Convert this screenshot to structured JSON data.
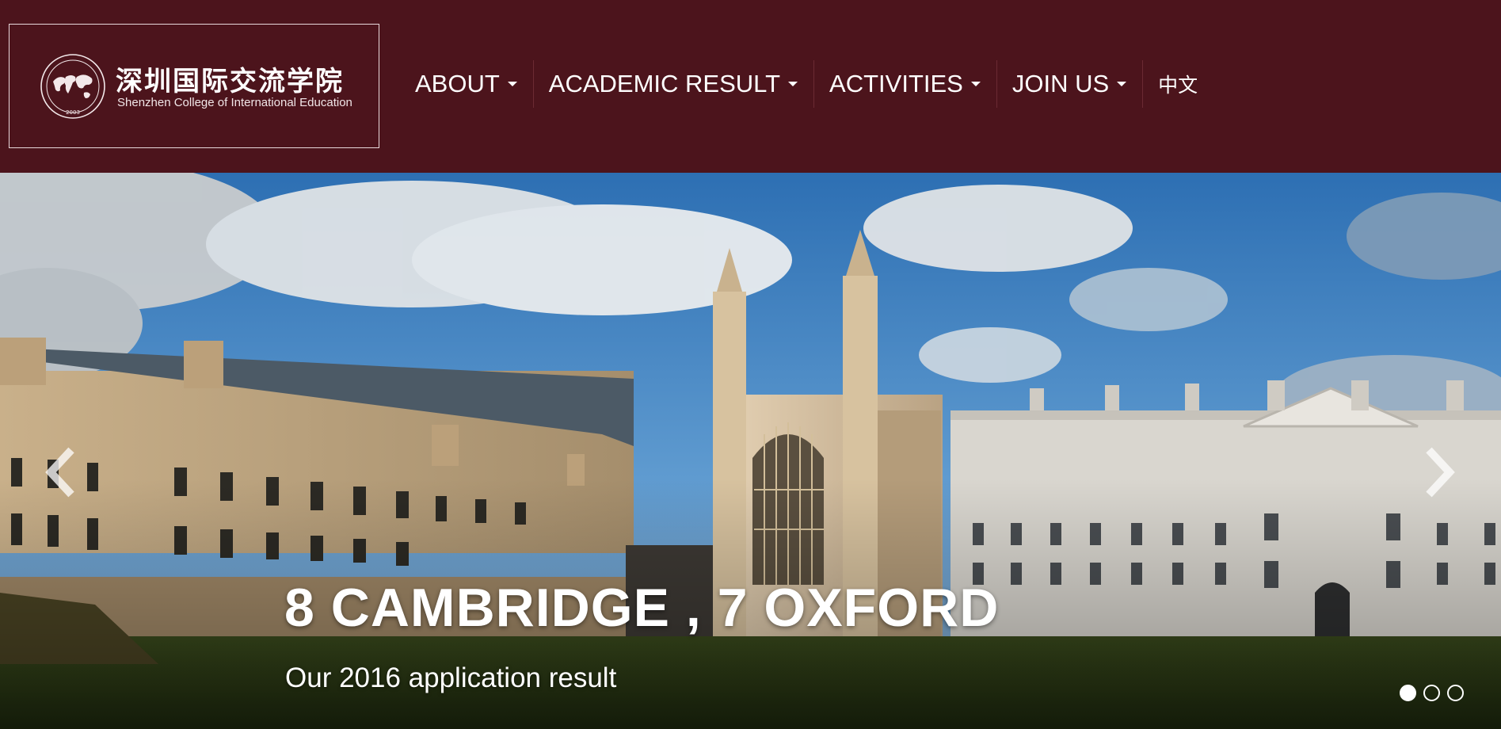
{
  "brand": {
    "name_cn": "深圳国际交流学院",
    "name_en": "Shenzhen College of International Education",
    "seal_year": "2003"
  },
  "nav": {
    "items": [
      {
        "label": "ABOUT",
        "has_dropdown": true
      },
      {
        "label": "ACADEMIC RESULT",
        "has_dropdown": true
      },
      {
        "label": "ACTIVITIES",
        "has_dropdown": true
      },
      {
        "label": "JOIN US",
        "has_dropdown": true
      }
    ],
    "language_label": "中文"
  },
  "hero": {
    "headline": "8 CAMBRIDGE , 7 OXFORD",
    "subline": "Our 2016 application result",
    "prev_icon": "chevron-left-icon",
    "next_icon": "chevron-right-icon",
    "slide_count": 3,
    "active_slide": 1
  },
  "colors": {
    "brand_maroon": "#4c141c",
    "text_white": "#ffffff",
    "sky_blue": "#3f86c6"
  }
}
